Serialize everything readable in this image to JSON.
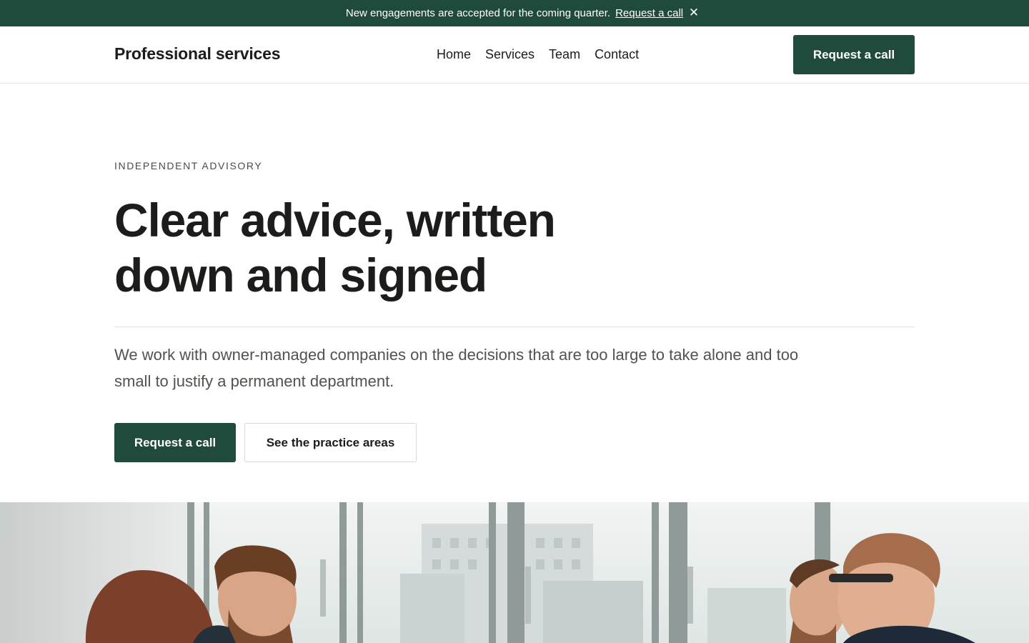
{
  "announcement": {
    "message": "New engagements are accepted for the coming quarter.",
    "link_label": "Request a call",
    "close_symbol": "✕"
  },
  "header": {
    "brand": "Professional services",
    "nav": [
      "Home",
      "Services",
      "Team",
      "Contact"
    ],
    "cta_label": "Request a call"
  },
  "hero": {
    "eyebrow": "INDEPENDENT ADVISORY",
    "headline_line1": "Clear advice, written",
    "headline_line2": "down and signed",
    "lede": "We work with owner-managed companies on the decisions that are too large to take alone and too small to justify a permanent department.",
    "primary_button": "Request a call",
    "secondary_button": "See the practice areas"
  },
  "colors": {
    "brand_green": "#1f4a3c",
    "text": "#1c1c1a",
    "muted_text": "#52524e"
  },
  "icons": {
    "close": "close-icon"
  }
}
